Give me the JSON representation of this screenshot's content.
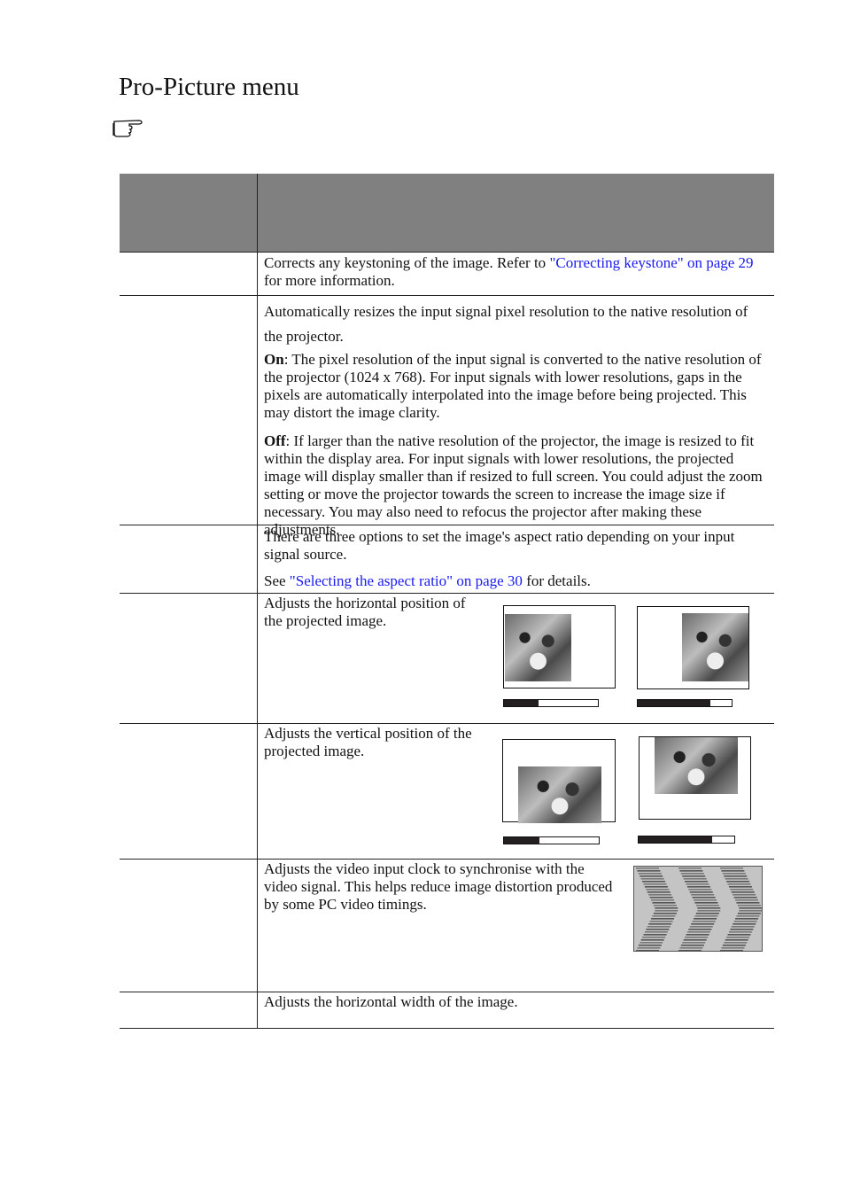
{
  "page": {
    "title": "Pro-Picture menu",
    "note_icon": "pointing-hand-icon"
  },
  "table": {
    "header": {
      "col1": "",
      "col2": ""
    },
    "rows": [
      {
        "label": "",
        "text_before": "Corrects any keystoning of the image. Refer to ",
        "link": "\"Correcting keystone\" on page 29",
        "text_after": " for more information."
      },
      {
        "label": "",
        "intro": "Automatically resizes the input signal pixel resolution to the native resolution of the projector.",
        "on_label": "On",
        "on_text": ": The pixel resolution of the input signal is converted to the native resolution of the projector (1024 x 768). For input signals with lower resolutions, gaps in the pixels are automatically interpolated into the image before being projected. This may distort the image clarity.",
        "off_label": "Off",
        "off_text": ": If larger than the native resolution of the projector, the image is resized to fit within the display area. For input signals with lower resolutions, the projected image will display smaller than if resized to full screen. You could adjust the zoom setting or move the projector towards the screen to increase the image size if necessary. You may also need to refocus the projector after making these adjustments."
      },
      {
        "label": "",
        "intro": "There are three options to set the image's aspect ratio depending on your input signal source.",
        "text_before": "See ",
        "link": "\"Selecting the aspect ratio\" on page 30",
        "text_after": "  for details."
      },
      {
        "label": "",
        "text": "Adjusts the horizontal position of the projected image.",
        "figure": {
          "left_bar_fill": 0.37,
          "right_bar_fill": 0.77
        }
      },
      {
        "label": "",
        "text": "Adjusts the vertical position of the projected image.",
        "figure": {
          "left_bar_fill": 0.37,
          "right_bar_fill": 0.77
        }
      },
      {
        "label": "",
        "text": "Adjusts the video input clock to synchronise with the video signal. This helps reduce image distortion produced by some PC video timings.",
        "figure": "chevron-distortion-pattern"
      },
      {
        "label": "",
        "text": "Adjusts the horizontal width of the image."
      }
    ]
  },
  "colors": {
    "header_bg": "#808080",
    "link": "#1a1aee",
    "bar_fill": "#231f20"
  }
}
